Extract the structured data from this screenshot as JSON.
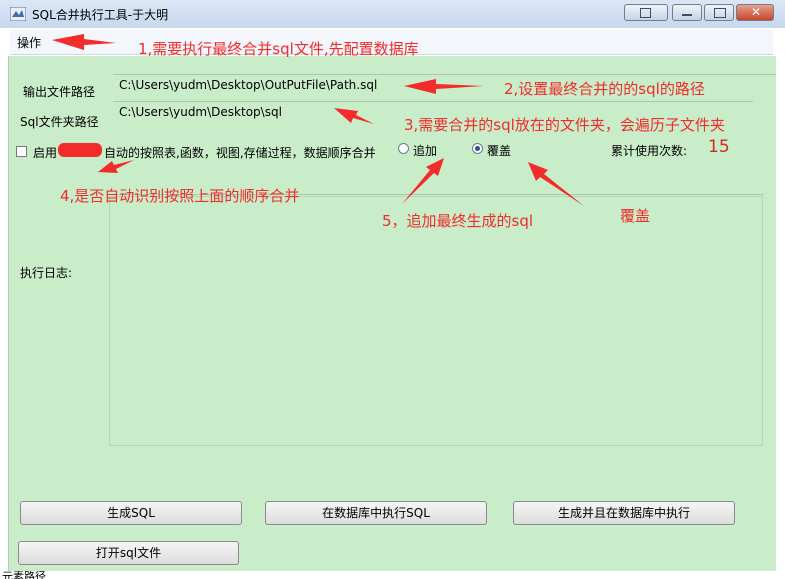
{
  "window": {
    "title": "SQL合并执行工具-于大明",
    "icon": "app-icon"
  },
  "menu": {
    "items": [
      "操作"
    ]
  },
  "form": {
    "output_label": "输出文件路径",
    "output_value": "C:\\Users\\yudm\\Desktop\\OutPutFile\\Path.sql",
    "folder_label": "Sql文件夹路径",
    "folder_value": "C:\\Users\\yudm\\Desktop\\sql",
    "auto_checkbox_label": "启用",
    "auto_checkbox_label_rest": "自动的按照表,函数，视图,存储过程，数据顺序合并",
    "auto_checked": false,
    "radio_append": "追加",
    "radio_overwrite": "覆盖",
    "selected_mode": "覆盖",
    "usage_label": "累计使用次数:",
    "usage_count": "15",
    "log_label": "执行日志:"
  },
  "buttons": {
    "generate": "生成SQL",
    "execute_db": "在数据库中执行SQL",
    "generate_execute": "生成并且在数据库中执行",
    "open_file": "打开sql文件"
  },
  "annotations": {
    "a1": "1,需要执行最终合并sql文件,先配置数据库",
    "a2": "2,设置最终合并的的sql的路径",
    "a3": "3,需要合并的sql放在的文件夹，会遍历子文件夹",
    "a4": "4,是否自动识别按照上面的顺序合并",
    "a5": "5，追加最终生成的sql",
    "a6": "覆盖"
  },
  "status": {
    "text": "元素路径"
  },
  "colors": {
    "form_bg": "#c9ecc9",
    "annotation": "#f22b2b",
    "counter": "#d42b1e"
  }
}
